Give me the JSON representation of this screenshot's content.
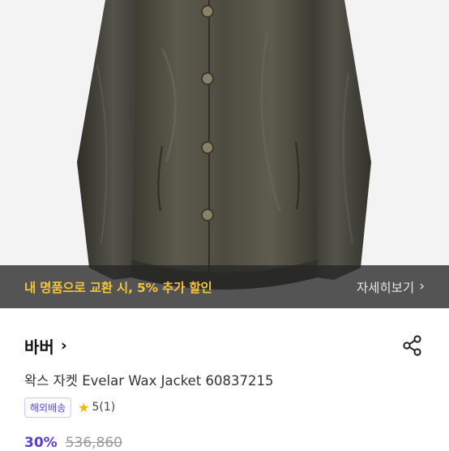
{
  "promo": {
    "message": "내 명품으로 교환 시, 5% 추가 할인",
    "link_label": "자세히보기",
    "link_chevron": "›"
  },
  "product": {
    "brand": "바버",
    "brand_chevron": "›",
    "title": "왁스 자켓 Evelar Wax Jacket 60837215",
    "badge": "해외배송",
    "rating_star": "★",
    "rating": "5(1)",
    "discount": "30%",
    "original_price": "536,860"
  },
  "icons": {
    "share": "share-icon"
  },
  "colors": {
    "promo_text": "#f3c33b",
    "accent": "#5a3bd8",
    "badge": "#5b4bd6",
    "star": "#f5b400"
  }
}
